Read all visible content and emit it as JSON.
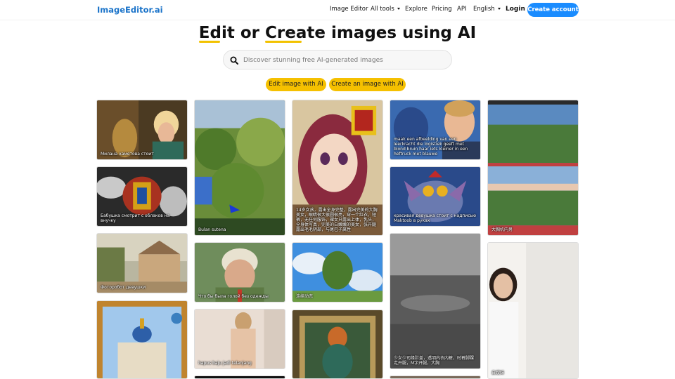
{
  "nav": {
    "logo": "ImageEditor.ai",
    "links": [
      "Image Editor",
      "All tools",
      "Explore",
      "Pricing",
      "API",
      "English"
    ],
    "login": "Login",
    "create_account": "Create account"
  },
  "hero": {
    "title_parts": [
      "Edit",
      " or ",
      "Create",
      " images using AI"
    ],
    "search_placeholder": "Discover stunning free AI-generated images",
    "buttons": [
      "Edit image with AI",
      "Create an image with AI"
    ]
  },
  "gallery": {
    "captions": [
      "Милана хаметова стоит",
      "Бабушка смотрит с облаков на внучку",
      "Фоторобот девушки",
      "Bulan sutena",
      "Что бы была голой без одежды",
      "hapus baju jadi telanjang",
      "14岁女孩，露出全身完整，露出完美的大胸美女，眼睛很大很圆很亮，穿一个红衣，短裤，无任何服饰，裸女只露出上体，乳头，全身体写真，完美的白嫩嫩的美女，张开腿露出毛毛阴部，与尾巴子属性",
      "连续动态",
      "maak een afbeelding van een leerkracht die logistiek geeft met blond bruin haar iets kleiner in een heftruck met blauwe",
      "красивая девушка стоит с надписью Maktoob в руках",
      "少女少司缘肚盖，透明内衣内裤，时裤脚踝走开腿，M字开腿，大胸",
      "大胸机内男",
      "白嫂妹"
    ]
  },
  "colors": {
    "brand": "#1a73c9",
    "primary_button": "#1a8cff",
    "accent": "#f5c000"
  },
  "icons": [
    "search-icon",
    "chevron-down-icon"
  ]
}
